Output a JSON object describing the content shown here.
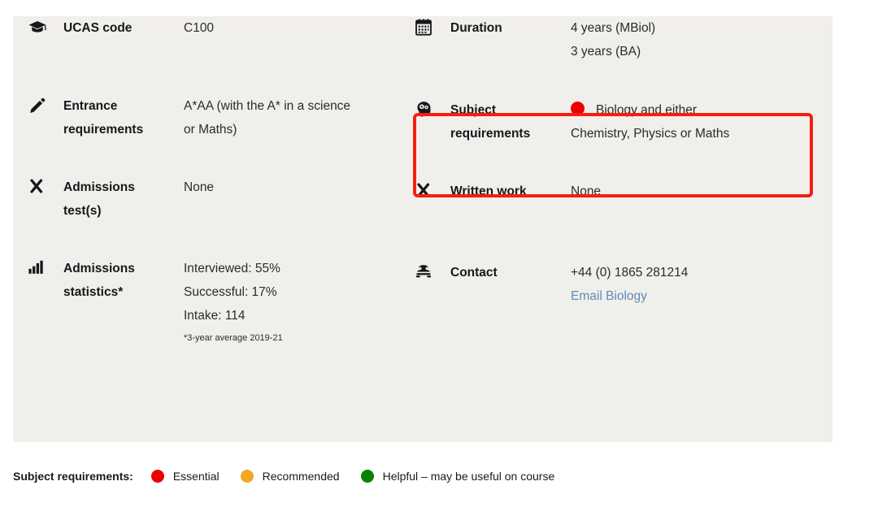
{
  "panel": {
    "background_color": "#f1efec",
    "left_column": [
      {
        "icon": "graduation-cap-icon",
        "label": "UCAS code",
        "values": [
          "C100"
        ]
      },
      {
        "icon": "pencil-icon",
        "label": "Entrance requirements",
        "label_line1": "Entrance",
        "label_line2": "requirements",
        "values": [
          "A*AA (with the A* in a science",
          "or Maths)"
        ]
      },
      {
        "icon": "cross-icon",
        "label": "Admissions test(s)",
        "label_line1": "Admissions",
        "label_line2": "test(s)",
        "values": [
          "None"
        ]
      },
      {
        "icon": "bar-chart-icon",
        "label": "Admissions statistics*",
        "label_line1": "Admissions",
        "label_line2": "statistics*",
        "values": [
          "Interviewed: 55%",
          "Successful: 17%",
          "Intake: 114"
        ],
        "footnote": "*3-year average 2019-21"
      }
    ],
    "right_column": [
      {
        "icon": "calendar-icon",
        "label": "Duration",
        "values": [
          "4 years (MBiol)",
          "3 years (BA)"
        ]
      },
      {
        "icon": "head-gears-icon",
        "label": "Subject requirements",
        "label_line1": "Subject",
        "label_line2": "requirements",
        "dot_color": "#ee0000",
        "dot_meaning": "Essential",
        "values": [
          "Biology and either",
          "Chemistry, Physics or Maths"
        ],
        "highlighted": true
      },
      {
        "icon": "cross-icon",
        "label": "Written work",
        "values": [
          "None"
        ]
      },
      {
        "icon": "telephone-icon",
        "label": "Contact",
        "values": [
          "+44 (0) 1865 281214"
        ],
        "link_text": "Email Biology"
      }
    ]
  },
  "highlight": {
    "color": "#f41f10",
    "target": "Subject requirements"
  },
  "legend": {
    "title": "Subject requirements:",
    "items": [
      {
        "label": "Essential",
        "color": "#ee0000"
      },
      {
        "label": "Recommended",
        "color": "#f5a623"
      },
      {
        "label": "Helpful – may be useful on course",
        "color": "#078107"
      }
    ]
  }
}
